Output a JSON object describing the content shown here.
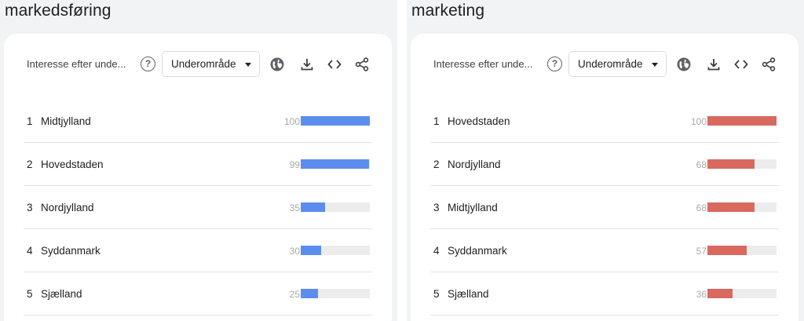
{
  "panels": [
    {
      "title": "markedsføring",
      "header_label": "Interesse efter unde...",
      "dropdown_label": "Underområde",
      "bar_color": "#5b8def",
      "rows": [
        {
          "rank": "1",
          "region": "Midtjylland",
          "value": 100
        },
        {
          "rank": "2",
          "region": "Hovedstaden",
          "value": 99
        },
        {
          "rank": "3",
          "region": "Nordjylland",
          "value": 35
        },
        {
          "rank": "4",
          "region": "Syddanmark",
          "value": 30
        },
        {
          "rank": "5",
          "region": "Sjælland",
          "value": 25
        }
      ]
    },
    {
      "title": "marketing",
      "header_label": "Interesse efter unde...",
      "dropdown_label": "Underområde",
      "bar_color": "#d9685e",
      "rows": [
        {
          "rank": "1",
          "region": "Hovedstaden",
          "value": 100
        },
        {
          "rank": "2",
          "region": "Nordjylland",
          "value": 68
        },
        {
          "rank": "3",
          "region": "Midtjylland",
          "value": 68
        },
        {
          "rank": "4",
          "region": "Syddanmark",
          "value": 57
        },
        {
          "rank": "5",
          "region": "Sjælland",
          "value": 36
        }
      ]
    }
  ],
  "toolbar_icons": [
    "globe-icon",
    "download-icon",
    "embed-code-icon",
    "share-icon"
  ],
  "help_icon_glyph": "?"
}
